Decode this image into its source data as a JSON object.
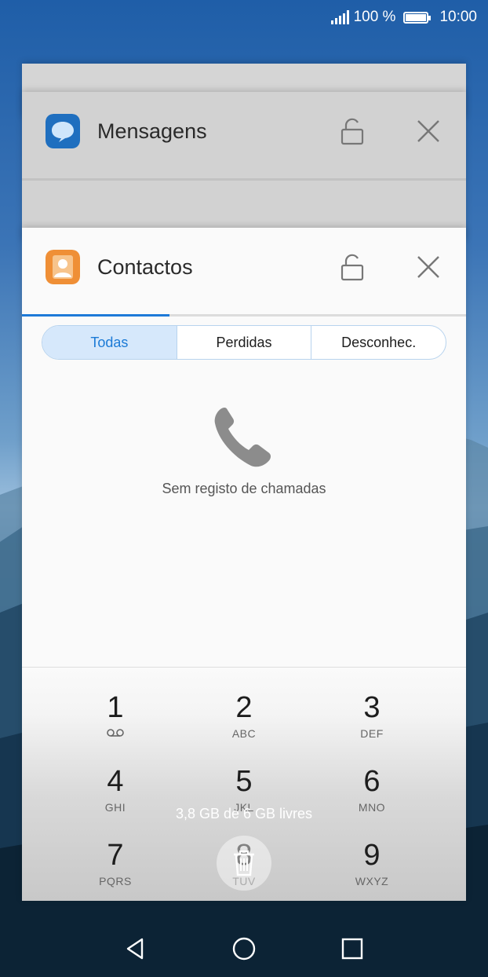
{
  "status_bar": {
    "battery_text": "100 %",
    "time": "10:00",
    "signal_icon": "signal-icon",
    "battery_icon": "battery-icon"
  },
  "recent_apps": [
    {
      "app": "Mensagens",
      "icon": "messages-app-icon",
      "color": "#1f6fbf"
    },
    {
      "app": "Contactos",
      "icon": "contacts-app-icon",
      "color": "#ef8f36"
    }
  ],
  "contacts_card": {
    "tabs": [
      "Todas",
      "Perdidas",
      "Desconhec."
    ],
    "selected_tab": "Todas",
    "empty_message": "Sem registo de chamadas",
    "keypad": [
      {
        "digit": "1",
        "letters": ""
      },
      {
        "digit": "2",
        "letters": "ABC"
      },
      {
        "digit": "3",
        "letters": "DEF"
      },
      {
        "digit": "4",
        "letters": "GHI"
      },
      {
        "digit": "5",
        "letters": "JKL"
      },
      {
        "digit": "6",
        "letters": "MNO"
      },
      {
        "digit": "7",
        "letters": "PQRS"
      },
      {
        "digit": "8",
        "letters": "TUV"
      },
      {
        "digit": "9",
        "letters": "WXYZ"
      }
    ]
  },
  "memory_info": "3,8 GB de 6 GB livres",
  "colors": {
    "accent": "#1e7ad8",
    "tab_selected_bg": "#d6e8fb"
  },
  "nav_bar": {
    "back_icon": "back-triangle-icon",
    "home_icon": "home-circle-icon",
    "recents_icon": "recents-square-icon"
  }
}
